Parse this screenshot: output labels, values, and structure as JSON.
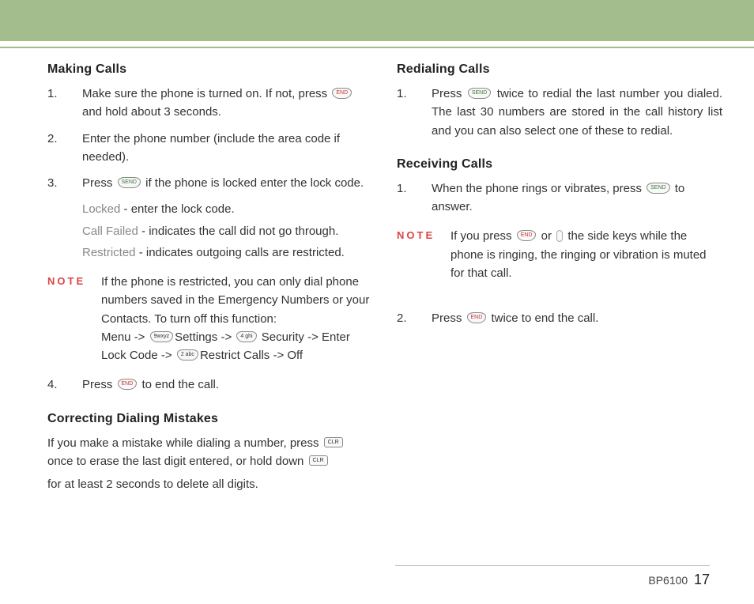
{
  "left": {
    "h_making": "Making Calls",
    "s1a": "Make sure the phone is turned on. If not, press ",
    "s1b": " and hold about 3 seconds.",
    "s2": "Enter the phone number (include the area code if needed).",
    "s3a": "Press ",
    "s3b": " if the phone is locked enter the lock code.",
    "sub1_l": "Locked",
    "sub1_t": " - enter the lock code.",
    "sub2_l": "Call Failed",
    "sub2_t": " - indicates the call did not go through.",
    "sub3_l": "Restricted",
    "sub3_t": " - indicates outgoing calls are restricted.",
    "note1a": "If the phone is restricted, you can only dial phone numbers saved in the Emergency Numbers or your Contacts. To turn off this function:",
    "note1b_menu": "Menu -> ",
    "note1b_settings": "Settings -> ",
    "note1b_security": " Security -> Enter Lock Code -> ",
    "note1b_restrict": "Restrict Calls -> Off",
    "s4a": "Press ",
    "s4b": " to end the call.",
    "h_correct": "Correcting Dialing Mistakes",
    "corr1a": "If you make a mistake while dialing a number, press ",
    "corr1b": " once to erase the last digit entered, or hold down ",
    "corr2": "for at least 2 seconds to delete all digits."
  },
  "right": {
    "h_redial": "Redialing Calls",
    "r1a": "Press ",
    "r1b": " twice to redial the last number you dialed. The last 30 numbers are stored in the call history list and you can also select one of these to redial.",
    "h_recv": "Receiving Calls",
    "rc1a": "When the phone rings or vibrates, press ",
    "rc1b": " to answer.",
    "note2a": "If you press ",
    "note2b": " or ",
    "note2c": " the side keys while the phone is ringing, the ringing or vibration is muted for that call.",
    "rc2a": "Press ",
    "rc2b": " twice to end the call."
  },
  "labels": {
    "note": "NOTE",
    "key_end": "END",
    "key_send": "SEND",
    "key_9": "9wxyz",
    "key_4": "4 ghi",
    "key_2": "2 abc",
    "key_clr": "CLR"
  },
  "footer": {
    "model": "BP6100",
    "page": "17"
  }
}
